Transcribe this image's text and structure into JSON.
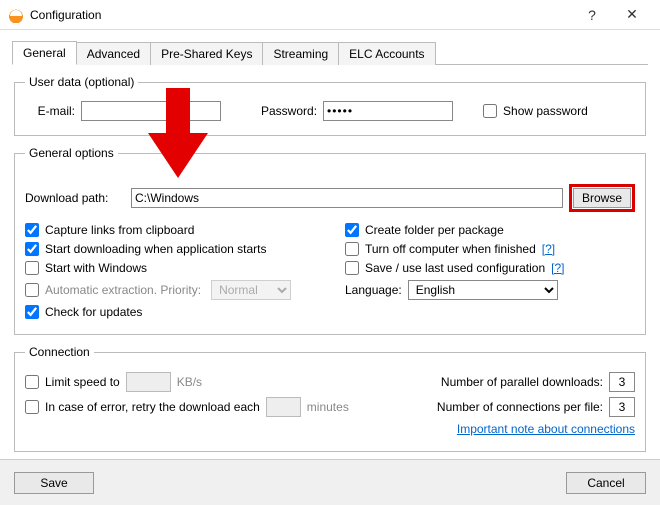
{
  "window": {
    "title": "Configuration",
    "help": "?",
    "close": "✕"
  },
  "tabs": [
    "General",
    "Advanced",
    "Pre-Shared Keys",
    "Streaming",
    "ELC Accounts"
  ],
  "userData": {
    "legend": "User data (optional)",
    "emailLabel": "E-mail:",
    "emailValue": "",
    "passwordLabel": "Password:",
    "passwordValue": "•••••",
    "showPasswordLabel": "Show password"
  },
  "generalOptions": {
    "legend": "General options",
    "downloadPathLabel": "Download path:",
    "downloadPathValue": "C:\\Windows",
    "browseLabel": "Browse",
    "left": {
      "captureLinks": "Capture links from clipboard",
      "startDownloading": "Start downloading when application starts",
      "startWithWindows": "Start with Windows",
      "autoExtract": "Automatic extraction. Priority:",
      "priorityValue": "Normal",
      "checkUpdates": "Check for updates"
    },
    "right": {
      "createFolder": "Create folder per package",
      "turnOff": "Turn off computer when finished",
      "saveLast": "Save / use last used configuration",
      "languageLabel": "Language:",
      "languageValue": "English",
      "help": "[?]"
    }
  },
  "connection": {
    "legend": "Connection",
    "limitSpeed": "Limit speed to",
    "limitUnit": "KB/s",
    "retry": "In case of error, retry the download each",
    "retryUnit": "minutes",
    "parallelLabel": "Number of parallel downloads:",
    "parallelValue": "3",
    "perFileLabel": "Number of connections per file:",
    "perFileValue": "3",
    "noteLink": "Important note about connections"
  },
  "footer": {
    "save": "Save",
    "cancel": "Cancel"
  }
}
